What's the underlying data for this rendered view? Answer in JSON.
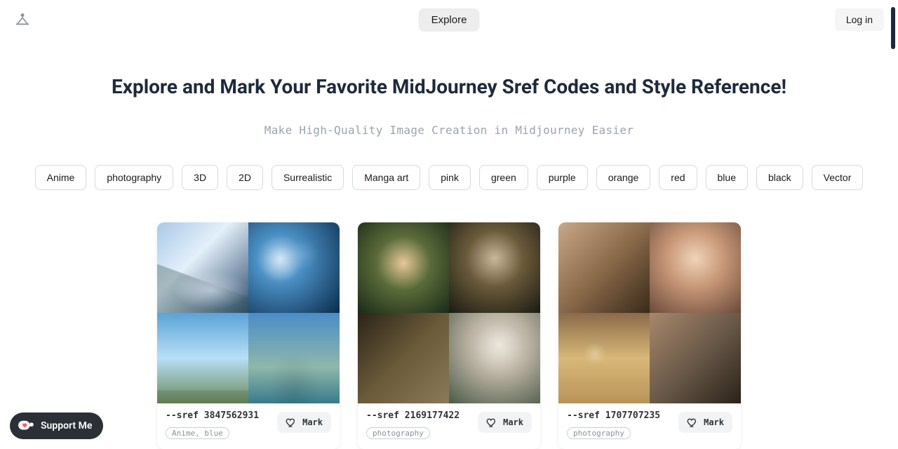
{
  "nav": {
    "explore": "Explore",
    "login": "Log in"
  },
  "hero": {
    "title": "Explore and Mark Your Favorite MidJourney Sref Codes and Style Reference!",
    "subtitle": "Make High-Quality Image Creation in Midjourney Easier"
  },
  "tags": [
    "Anime",
    "photography",
    "3D",
    "2D",
    "Surrealistic",
    "Manga art",
    "pink",
    "green",
    "purple",
    "orange",
    "red",
    "blue",
    "black",
    "Vector"
  ],
  "cards": [
    {
      "sref": "--sref 3847562931",
      "badge": "Anime, blue",
      "mark": "Mark"
    },
    {
      "sref": "--sref 2169177422",
      "badge": "photography",
      "mark": "Mark"
    },
    {
      "sref": "--sref 1707707235",
      "badge": "photography",
      "mark": "Mark"
    }
  ],
  "support": "Support Me"
}
